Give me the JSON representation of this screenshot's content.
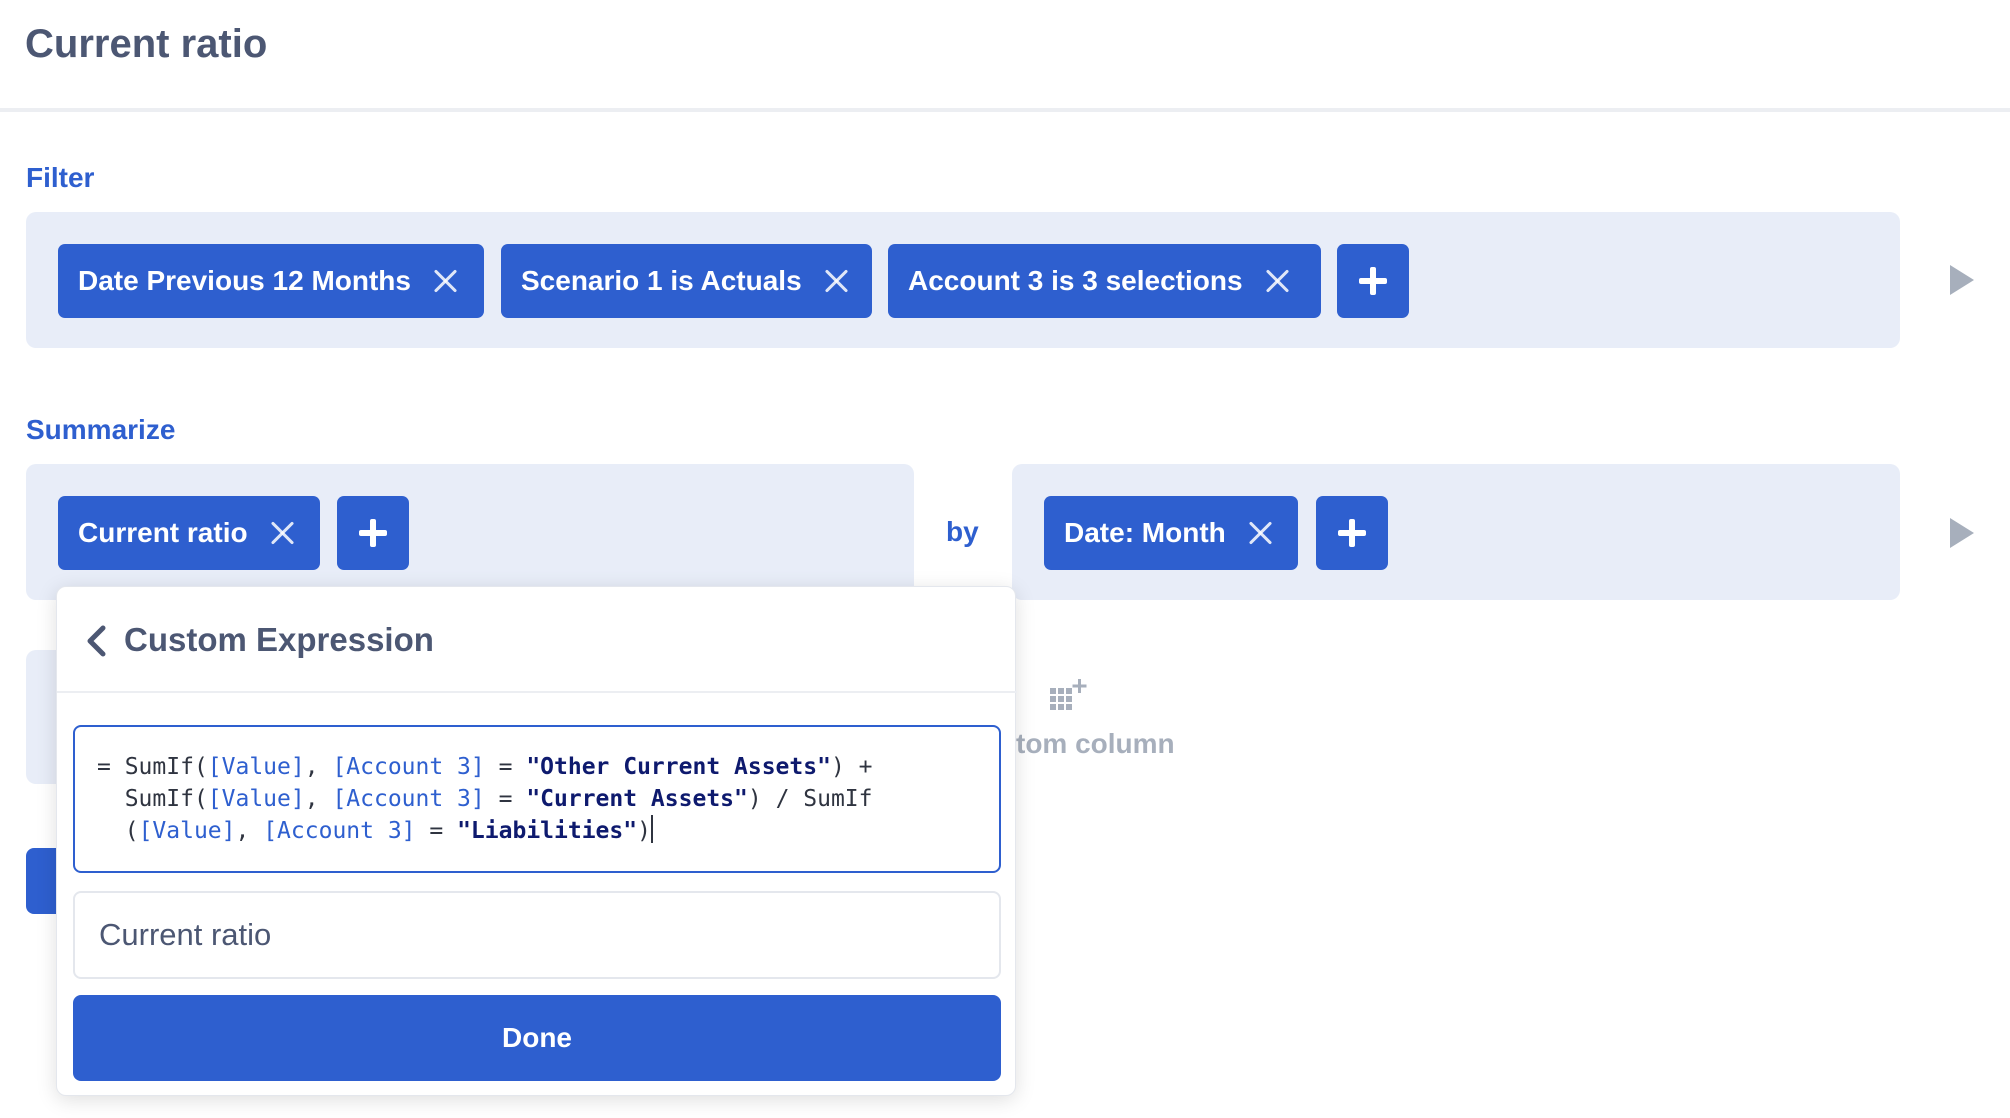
{
  "page": {
    "title": "Current ratio"
  },
  "filter": {
    "label": "Filter",
    "chips": [
      {
        "label": "Date Previous 12 Months"
      },
      {
        "label": "Scenario 1 is Actuals"
      },
      {
        "label": "Account 3 is 3 selections"
      }
    ]
  },
  "summarize": {
    "label": "Summarize",
    "metrics": [
      {
        "label": "Current ratio"
      }
    ],
    "by_label": "by",
    "groupings": [
      {
        "label": "Date: Month"
      }
    ]
  },
  "custom_column": {
    "label": "tom column"
  },
  "popover": {
    "title": "Custom Expression",
    "expression": {
      "line1": {
        "eq": "= ",
        "fn1": "SumIf(",
        "f1": "[Value]",
        "c1": ", ",
        "f2": "[Account 3]",
        "op1": " = ",
        "s1": "\"Other Current Assets\"",
        "end1": ") +"
      },
      "line2": {
        "fn1": "SumIf(",
        "f1": "[Value]",
        "c1": ", ",
        "f2": "[Account 3]",
        "op1": " = ",
        "s1": "\"Current Assets\"",
        "end1": ") / SumIf"
      },
      "line3": {
        "open": "(",
        "f1": "[Value]",
        "c1": ", ",
        "f2": "[Account 3]",
        "op1": " = ",
        "s1": "\"Liabilities\"",
        "end1": ")"
      }
    },
    "name_value": "Current ratio",
    "done_label": "Done"
  },
  "colors": {
    "accent": "#2e5fcf",
    "panel_bg": "#e8edf8",
    "muted": "#a7afbc"
  },
  "icons": {
    "remove": "close-icon",
    "add": "plus-icon",
    "run": "play-icon",
    "back": "chevron-left-icon",
    "custom_column": "grid-plus-icon"
  }
}
